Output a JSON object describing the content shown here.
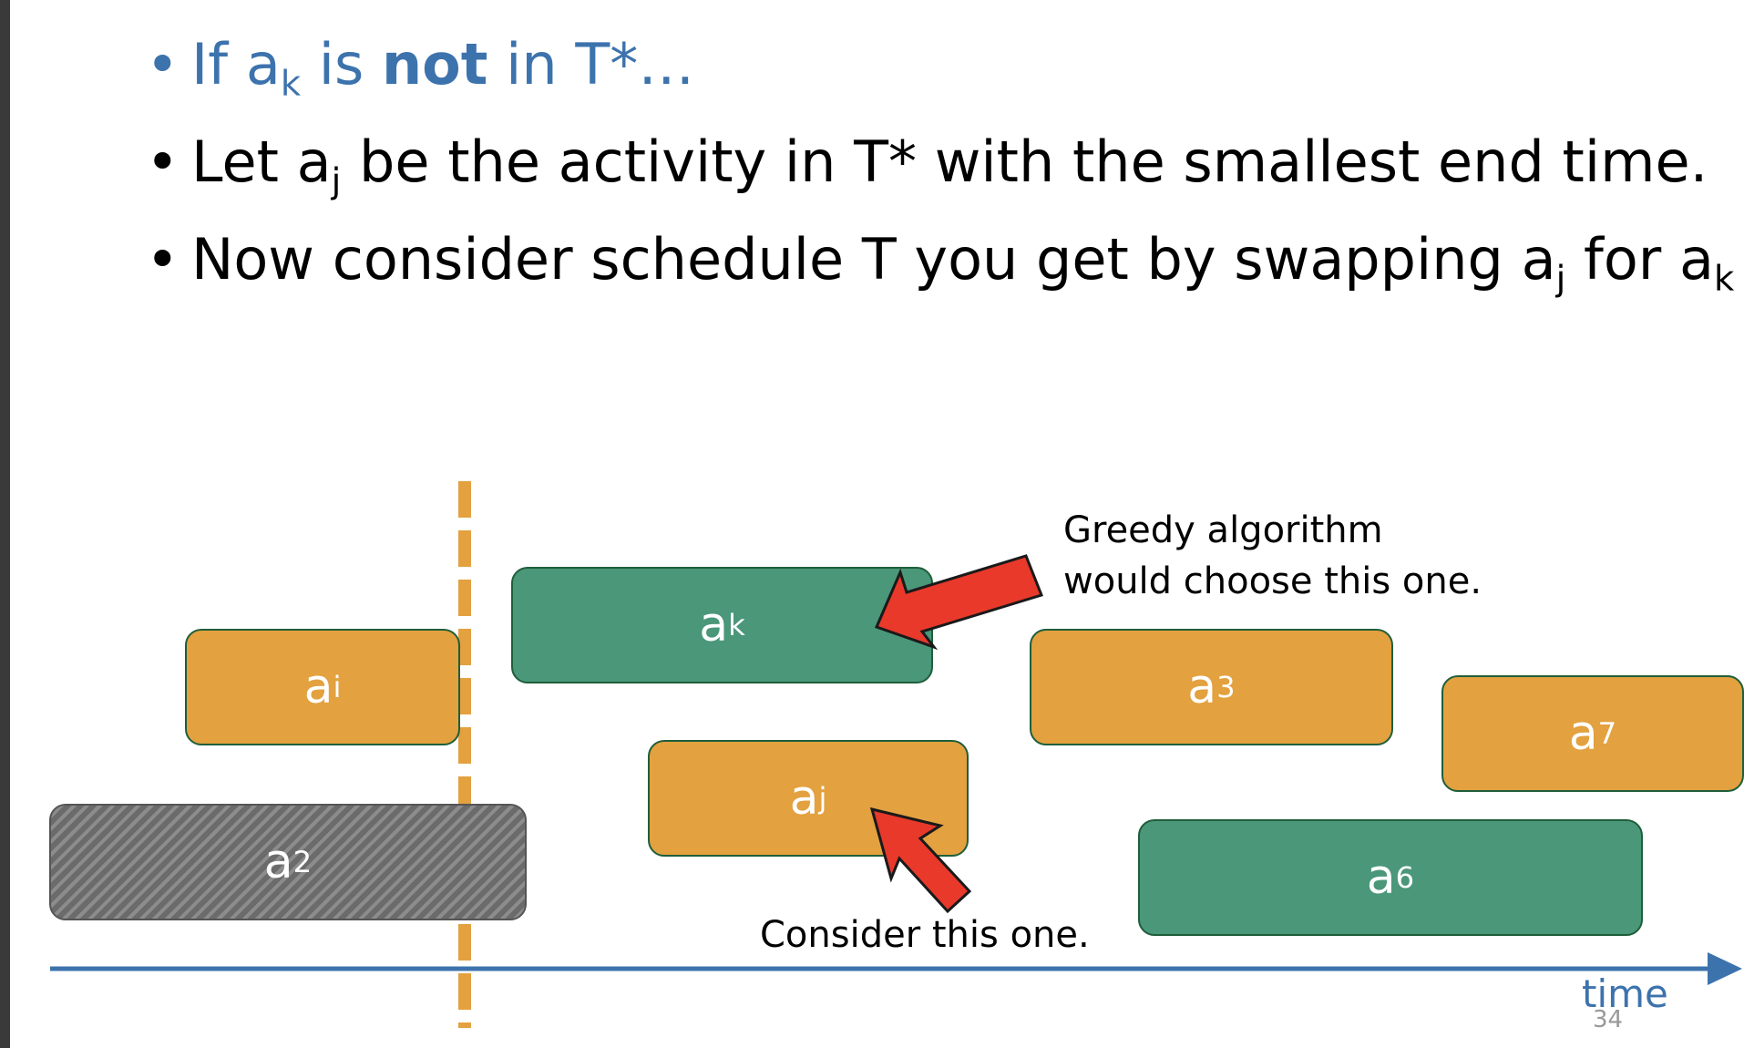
{
  "bullets": [
    {
      "parts": [
        "If a",
        "k",
        " is ",
        "not",
        " in T*…"
      ]
    },
    {
      "parts": [
        "Let a",
        "j",
        " be the activity in T* with the smallest end time."
      ]
    },
    {
      "parts": [
        "Now consider schedule T you get by swapping a",
        "j",
        " for a",
        "k"
      ]
    }
  ],
  "activities": [
    {
      "base": "a",
      "sub": "i",
      "color": "orange"
    },
    {
      "base": "a",
      "sub": "k",
      "color": "green"
    },
    {
      "base": "a",
      "sub": "3",
      "color": "orange"
    },
    {
      "base": "a",
      "sub": "7",
      "color": "orange"
    },
    {
      "base": "a",
      "sub": "j",
      "color": "orange"
    },
    {
      "base": "a",
      "sub": "2",
      "color": "gray"
    },
    {
      "base": "a",
      "sub": "6",
      "color": "green"
    }
  ],
  "annotations": {
    "greedy_line1": "Greedy algorithm",
    "greedy_line2": "would choose this one.",
    "consider": "Consider this one."
  },
  "axis": {
    "label": "time"
  },
  "page_number": "34",
  "colors": {
    "orange": "#e3a13f",
    "green": "#4a977a",
    "blue": "#3d73ad",
    "arrow": "#e8392b"
  }
}
